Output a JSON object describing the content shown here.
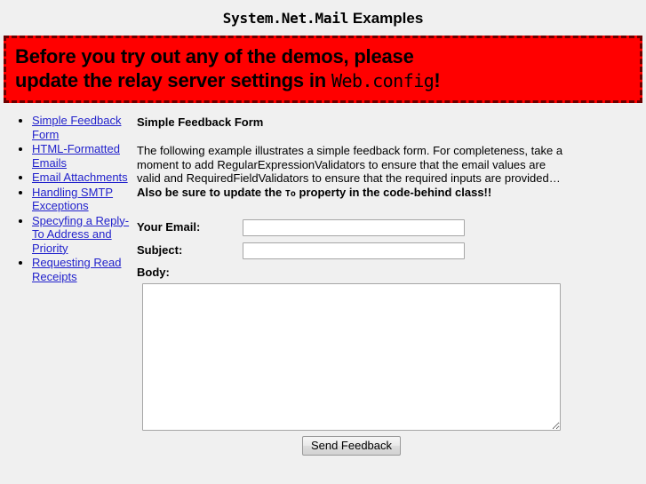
{
  "header": {
    "title_mono": "System.Net.Mail",
    "title_rest": " Examples"
  },
  "warning": {
    "line1": "Before you try out any of the demos, please",
    "line2_pre": "update the relay server settings in ",
    "line2_mono": "Web.config",
    "line2_post": "!"
  },
  "sidebar": {
    "items": [
      {
        "label": "Simple Feedback Form"
      },
      {
        "label": "HTML-Formatted Emails"
      },
      {
        "label": "Email Attachments"
      },
      {
        "label": "Handling SMTP Exceptions"
      },
      {
        "label": "Specyfing a Reply-To Address and Priority"
      },
      {
        "label": "Requesting Read Receipts"
      }
    ]
  },
  "main": {
    "heading": "Simple Feedback Form",
    "intro_part1": "The following example illustrates a simple feedback form. For completeness, take a moment to add RegularExpressionValidators to ensure that the email values are valid and RequiredFieldValidators to ensure that the required inputs are provided… ",
    "intro_bold_part1": "Also be sure to update the ",
    "intro_mono": "To",
    "intro_bold_part2": " property in the code-behind class!!"
  },
  "form": {
    "email_label": "Your Email:",
    "email_value": "",
    "subject_label": "Subject:",
    "subject_value": "",
    "body_label": "Body:",
    "body_value": "",
    "submit_label": "Send Feedback"
  },
  "colors": {
    "page_background": "#f0f0f0",
    "banner_background": "#ff0000",
    "banner_border": "#6b0000",
    "link": "#2222cc",
    "input_border": "#a6a6a6"
  }
}
